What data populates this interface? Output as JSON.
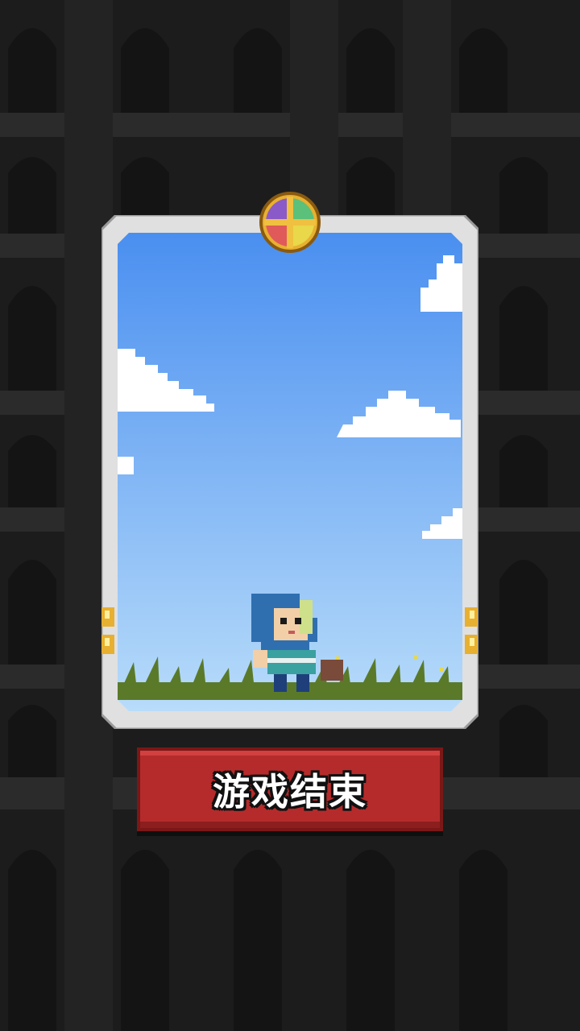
{
  "screen": {
    "name": "game-over-screen",
    "background_color": "#1c1c1c",
    "arch_color": "#2a2a2a",
    "sky_top_color": "#4a8ff0",
    "sky_bottom_color": "#b8dcfa"
  },
  "card": {
    "frame_color": "#d8d8d8",
    "grass_color": "#5a7a2a"
  },
  "button": {
    "label": "游戏结束",
    "color": "#b52b2b"
  },
  "icons": {
    "emblem": "four-color-cross-emblem-icon",
    "character": "blue-hooded-hero-icon",
    "side_gems": "gold-gem-icon"
  }
}
